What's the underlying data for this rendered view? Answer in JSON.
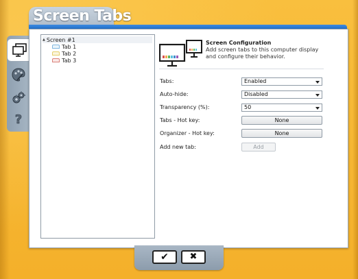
{
  "app": {
    "title": "Screen Tabs"
  },
  "side_tabs": [
    {
      "name": "screens-tab",
      "icon": "monitor-icon",
      "active": true
    },
    {
      "name": "appearance-tab",
      "icon": "palette-icon",
      "active": false
    },
    {
      "name": "settings-tab",
      "icon": "gears-icon",
      "active": false
    },
    {
      "name": "help-tab",
      "icon": "question-icon",
      "active": false
    }
  ],
  "tree": {
    "root": {
      "label": "Screen #1",
      "expander": "▲"
    },
    "items": [
      {
        "label": "Tab 1",
        "color": "#7fb6e0"
      },
      {
        "label": "Tab 2",
        "color": "#e6cf6a"
      },
      {
        "label": "Tab 3",
        "color": "#d98079"
      }
    ]
  },
  "config": {
    "title": "Screen Configuration",
    "description": "Add screen tabs to this computer display and configure their behavior."
  },
  "form": {
    "tabs": {
      "label": "Tabs:",
      "value": "Enabled"
    },
    "auto_hide": {
      "label": "Auto-hide:",
      "value": "Disabled"
    },
    "transparency": {
      "label": "Transparency (%):",
      "value": "50"
    },
    "tabs_hotkey": {
      "label": "Tabs - Hot key:",
      "value": "None"
    },
    "organizer_hotkey": {
      "label": "Organizer - Hot key:",
      "value": "None"
    },
    "add_new_tab": {
      "label": "Add new tab:",
      "button": "Add"
    }
  },
  "actions": {
    "ok": {
      "glyph": "✔"
    },
    "cancel": {
      "glyph": "✖"
    }
  }
}
